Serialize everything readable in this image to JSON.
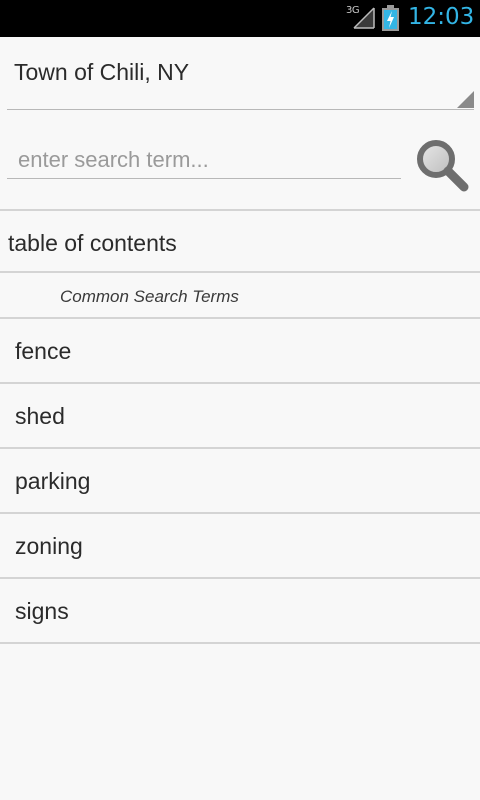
{
  "status_bar": {
    "network": "3G",
    "time": "12:03",
    "icons": [
      "signal-icon",
      "battery-charging-icon"
    ],
    "clock_color": "#33b5e5"
  },
  "location_spinner": {
    "selected": "Town of Chili, NY"
  },
  "search": {
    "placeholder": "enter search term...",
    "value": "",
    "button_icon": "search-icon"
  },
  "toc": {
    "label": "table of contents"
  },
  "common_terms": {
    "header": "Common Search Terms",
    "items": [
      {
        "label": "fence"
      },
      {
        "label": "shed"
      },
      {
        "label": "parking"
      },
      {
        "label": "zoning"
      },
      {
        "label": "signs"
      }
    ]
  }
}
